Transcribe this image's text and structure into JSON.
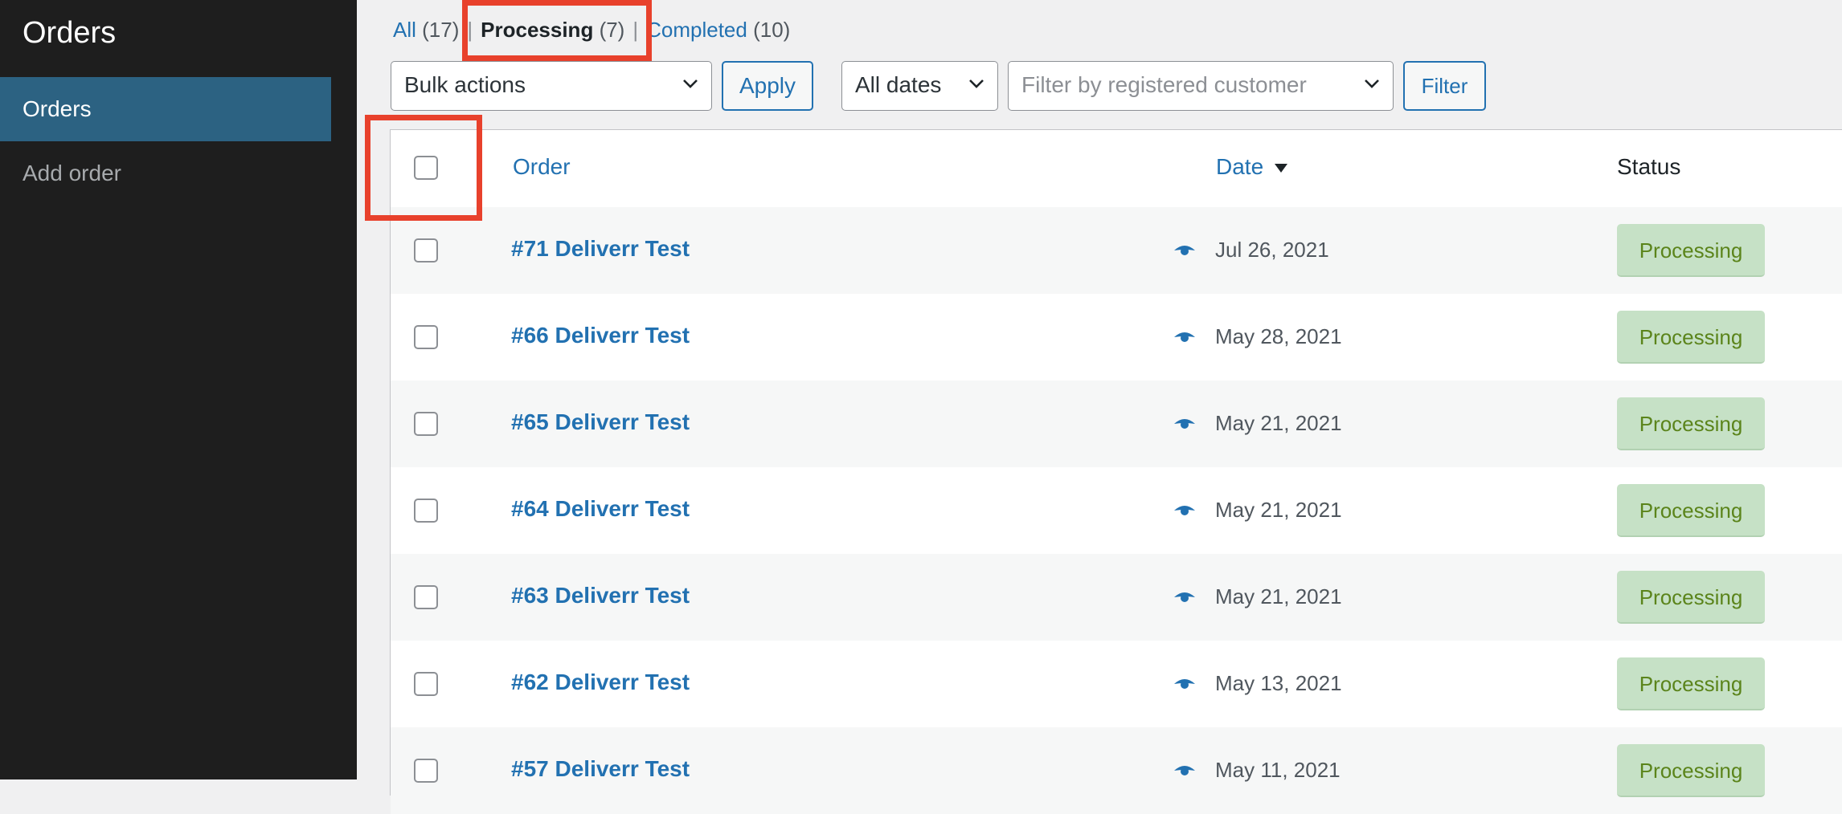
{
  "sidebar": {
    "title": "Orders",
    "items": [
      {
        "label": "Orders",
        "active": true
      },
      {
        "label": "Add order",
        "active": false
      }
    ]
  },
  "views": {
    "all": {
      "label": "All",
      "count": "(17)"
    },
    "processing": {
      "label": "Processing",
      "count": "(7)"
    },
    "completed": {
      "label": "Completed",
      "count": "(10)"
    },
    "separator": "|"
  },
  "filters": {
    "bulk_actions": "Bulk actions",
    "apply": "Apply",
    "dates": "All dates",
    "customer_placeholder": "Filter by registered customer",
    "filter": "Filter"
  },
  "table": {
    "columns": {
      "order": "Order",
      "date": "Date",
      "status": "Status"
    },
    "rows": [
      {
        "order": "#71 Deliverr Test",
        "date": "Jul 26, 2021",
        "status": "Processing"
      },
      {
        "order": "#66 Deliverr Test",
        "date": "May 28, 2021",
        "status": "Processing"
      },
      {
        "order": "#65 Deliverr Test",
        "date": "May 21, 2021",
        "status": "Processing"
      },
      {
        "order": "#64 Deliverr Test",
        "date": "May 21, 2021",
        "status": "Processing"
      },
      {
        "order": "#63 Deliverr Test",
        "date": "May 21, 2021",
        "status": "Processing"
      },
      {
        "order": "#62 Deliverr Test",
        "date": "May 13, 2021",
        "status": "Processing"
      },
      {
        "order": "#57 Deliverr Test",
        "date": "May 11, 2021",
        "status": "Processing"
      }
    ]
  },
  "colors": {
    "accent": "#2271b1",
    "sidebar_bg": "#1e1e1e",
    "sidebar_active": "#2c6282",
    "status_bg": "#c6e1c6",
    "status_text": "#5b841b",
    "highlight": "#e8412c"
  },
  "icons": {
    "preview": "eye-icon",
    "dropdown": "chevron-down-icon",
    "sort": "sort-desc-icon"
  }
}
